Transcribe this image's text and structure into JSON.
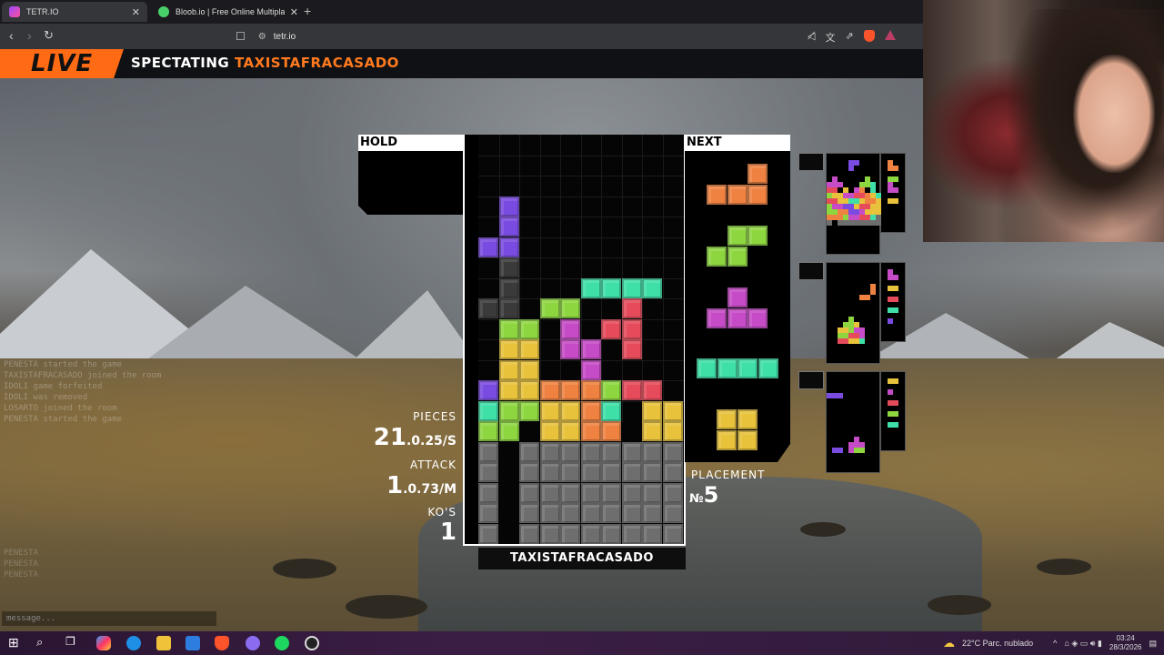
{
  "browser": {
    "tabs": [
      {
        "title": "TETR.IO",
        "active": true,
        "icon": "tetrio-favicon"
      },
      {
        "title": "Bloob.io | Free Online Multiplayer Ga",
        "active": false,
        "icon": "bloob-favicon"
      }
    ],
    "close_glyph": "✕",
    "new_tab_glyph": "+",
    "url": "tetr.io"
  },
  "banner": {
    "live_label": "LIVE",
    "spectating_label": "SPECTATING",
    "player_name": "TAXISTAFRACASADO"
  },
  "board": {
    "hold_label": "HOLD",
    "next_label": "NEXT",
    "player_name": "TAXISTAFRACASADO",
    "colors": {
      "I": "#3ee0a8",
      "O": "#e8c23b",
      "T": "#c64bc6",
      "S": "#8ed640",
      "Z": "#e54b5b",
      "J": "#7a4be0",
      "L": "#ef8240",
      "G": "#6e6e6e",
      "ghost": "#3a3a3a"
    },
    "rows": [
      "..........",
      "..........",
      "..........",
      ".J........",
      ".J........",
      "JJ........",
      ".X........",
      ".X...IIII.",
      "XX.SS..Z..",
      ".SS.T.ZZ..",
      ".OO.TT.Z..",
      ".OO..T....",
      "JOOLLLSZZ.",
      "ISSOOLI.OO",
      "SS.OOLL.OO",
      "G.GGGGGGGG",
      "G.GGGGGGGG",
      "G.GGGGGGGG",
      "G.GGGGGGGG",
      "G.GGGGGGGG"
    ]
  },
  "next_queue": [
    "L",
    "S",
    "T",
    "I",
    "O"
  ],
  "stats": {
    "pieces_label": "PIECES",
    "pieces_value": "21",
    "pieces_rate": ".0.25/S",
    "attack_label": "ATTACK",
    "attack_value": "1",
    "attack_rate": ".0.73/M",
    "kos_label": "KO'S",
    "kos_value": "1",
    "placement_label": "PLACEMENT",
    "placement_prefix": "№",
    "placement_value": "5"
  },
  "chat": {
    "placeholder": "message...",
    "log_top": [
      "PENESTA started the game",
      "TAXISTAFRACASADO joined the room",
      "IDOLI game forfeited",
      "IDOLI was removed",
      "LOSARTO joined the room",
      "PENESTA started the game"
    ],
    "log_bottom": [
      "PENESTA",
      "PENESTA",
      "PENESTA"
    ]
  },
  "taskbar": {
    "weather": "22°C  Parc. nublado",
    "time": "03:24",
    "date": "28/3/2026"
  }
}
